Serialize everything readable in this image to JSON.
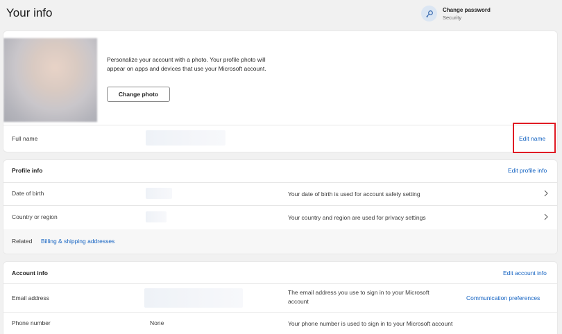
{
  "header": {
    "title": "Your info",
    "change_password_title": "Change password",
    "change_password_sub": "Security"
  },
  "photo_card": {
    "description": "Personalize your account with a photo. Your profile photo will appear on apps and devices that use your Microsoft account.",
    "change_photo_label": "Change photo",
    "full_name_label": "Full name",
    "edit_name_label": "Edit name"
  },
  "profile_info": {
    "title": "Profile info",
    "edit_label": "Edit profile info",
    "rows": [
      {
        "label": "Date of birth",
        "desc": "Your date of birth is used for account safety setting"
      },
      {
        "label": "Country or region",
        "desc": "Your country and region are used for privacy settings"
      }
    ],
    "related_label": "Related",
    "related_link": "Billing & shipping addresses"
  },
  "account_info": {
    "title": "Account info",
    "edit_label": "Edit account info",
    "email_label": "Email address",
    "email_desc": "The email address you use to sign in to your Microsoft account",
    "email_link": "Communication preferences",
    "phone_label": "Phone number",
    "phone_value": "None",
    "phone_desc": "Your phone number is used to sign in to your Microsoft account"
  },
  "colors": {
    "accent": "#1463c2",
    "highlight": "#e01b24"
  }
}
